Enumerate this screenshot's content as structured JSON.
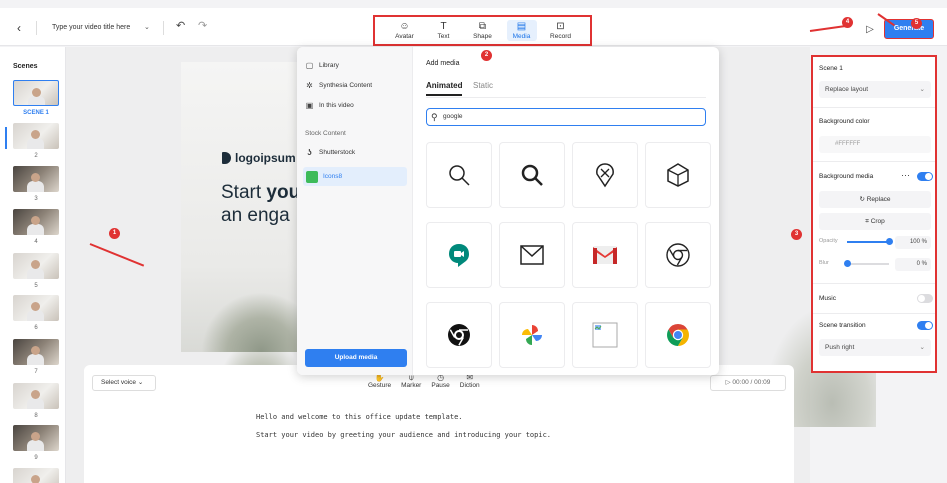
{
  "header": {
    "back_icon": "chevron-left-icon",
    "video_title": "Type your video title here",
    "undo_icon": "undo-icon",
    "redo_icon": "redo-icon",
    "tools": [
      {
        "label": "Avatar",
        "icon": "avatar-icon",
        "glyph": "☺"
      },
      {
        "label": "Text",
        "icon": "text-icon",
        "glyph": "T"
      },
      {
        "label": "Shape",
        "icon": "shape-icon",
        "glyph": "⧉"
      },
      {
        "label": "Media",
        "icon": "media-icon",
        "glyph": "▤",
        "active": true
      },
      {
        "label": "Record",
        "icon": "record-icon",
        "glyph": "⊡"
      }
    ],
    "play_icon": "play-icon",
    "generate_label": "Generate"
  },
  "badges": [
    "1",
    "2",
    "3",
    "4",
    "5"
  ],
  "scenes": {
    "title": "Scenes",
    "selected_label": "SCENE 1",
    "numbers": [
      "2",
      "3",
      "4",
      "5",
      "6",
      "7",
      "8",
      "9"
    ]
  },
  "canvas": {
    "logo_text": "logoipsum",
    "headline_1_plain": "Start ",
    "headline_1_bold": "you",
    "headline_2": "an enga"
  },
  "media_popup": {
    "nav": [
      {
        "label": "Library",
        "icon": "library-icon",
        "glyph": "▢"
      },
      {
        "label": "Synthesia Content",
        "icon": "synthesia-icon",
        "glyph": "✲"
      },
      {
        "label": "In this video",
        "icon": "film-icon",
        "glyph": "▣"
      }
    ],
    "stock_section": "Stock Content",
    "stock": [
      {
        "label": "Shutterstock",
        "icon": "shutterstock-icon"
      },
      {
        "label": "Icons8",
        "icon": "icons8-icon",
        "active": true
      }
    ],
    "upload_label": "Upload media",
    "add_media_title": "Add media",
    "tabs": [
      {
        "label": "Animated",
        "active": true
      },
      {
        "label": "Static"
      }
    ],
    "search_value": "google",
    "search_icon": "search-icon",
    "results": [
      "magnifier-thin-icon",
      "magnifier-bold-icon",
      "map-pin-icon",
      "cube-icon",
      "google-meet-icon",
      "mail-outline-icon",
      "gmail-icon",
      "chrome-outline-icon",
      "chrome-black-icon",
      "google-photos-icon",
      "broken-image-icon",
      "chrome-color-icon"
    ]
  },
  "script_panel": {
    "voice_label": "Select voice",
    "tools": [
      {
        "label": "Gesture",
        "icon": "gesture-icon",
        "glyph": "✋"
      },
      {
        "label": "Marker",
        "icon": "marker-icon",
        "glyph": "⍦"
      },
      {
        "label": "Pause",
        "icon": "pause-icon",
        "glyph": "◷"
      },
      {
        "label": "Diction",
        "icon": "diction-icon",
        "glyph": "✉"
      }
    ],
    "timer": "00:00 / 00:09",
    "lines": [
      "Hello and welcome to this office update template.",
      "Start your video by greeting your audience and introducing your topic."
    ]
  },
  "right_panel": {
    "scene_title": "Scene 1",
    "layout_label": "Replace layout",
    "bg_color_title": "Background color",
    "bg_color_value": "#FFFFFF",
    "bg_media_title": "Background media",
    "more_icon": "more-icon",
    "bg_media_on": true,
    "replace_label": "Replace",
    "crop_label": "Crop",
    "opacity_label": "Opacity",
    "opacity_value": "100",
    "opacity_fraction": 1.0,
    "blur_label": "Blur",
    "blur_value": "0",
    "blur_fraction": 0.0,
    "percent_unit": "%",
    "music_label": "Music",
    "music_on": false,
    "transition_label": "Scene transition",
    "transition_on": true,
    "transition_value": "Push right"
  },
  "colors": {
    "accent": "#2f7ff0",
    "annotation_red": "#e03232"
  }
}
